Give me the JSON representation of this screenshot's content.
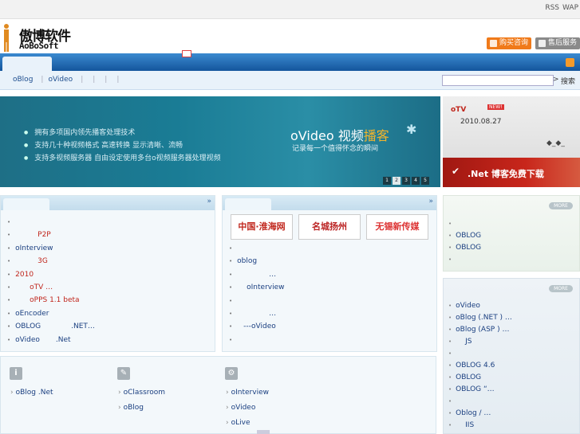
{
  "top": {
    "links": [
      "RSS",
      "WAP"
    ]
  },
  "logo": {
    "cn": "傲博软件",
    "en": "AoBoSoft"
  },
  "header": {
    "buy": "购买咨询",
    "after_sale": "售后服务"
  },
  "subnav": {
    "links": [
      "oBlog",
      "oVideo"
    ],
    "separators": [
      "|",
      "|",
      "|",
      "|",
      "|"
    ],
    "search_arrow": ">",
    "search_button": "搜索"
  },
  "banner": {
    "bullets": [
      "拥有多项国内领先播客处理技术",
      "支持几十种视频格式 高速转换 显示清晰、流畅",
      "支持多视频服务器 自由设定使用多台o视频服务器处理视频"
    ],
    "title_prefix": "oVideo 视频",
    "title_em": "播客",
    "subtitle": "记录每一个值得怀念的瞬间",
    "star": "✱",
    "pages": [
      "1",
      "2",
      "3",
      "4",
      "5"
    ]
  },
  "promo": {
    "tag": "oTV",
    "new": "NEW!",
    "date": "2010.08.27",
    "face": "◆_◆_",
    "check": "✔",
    "text": ".Net 博客免费下载"
  },
  "panel_left": {
    "chevron": "»",
    "items": [
      {
        "a": "",
        "b": ""
      },
      {
        "a": "",
        "b": "P2P"
      },
      {
        "a": "oInterview",
        "b": ""
      },
      {
        "a": "",
        "b": "3G"
      },
      {
        "a": "2010",
        "b": ""
      },
      {
        "a": "",
        "b": "oTV          …"
      },
      {
        "a": "",
        "b": "oPPS  1.1 beta"
      },
      {
        "a": "oEncoder",
        "b": ""
      },
      {
        "a": "OBLOG",
        "b": ".NET…"
      },
      {
        "a": "oVideo",
        "b": ".Net"
      }
    ]
  },
  "panel_mid": {
    "chevron": "»",
    "logos": [
      "中国·淮海网",
      "名城扬州",
      "无锡新传媒"
    ],
    "items": [
      "",
      "oblog",
      "…",
      "oInterview",
      "",
      "…",
      "---oVideo",
      ""
    ]
  },
  "side1": {
    "more": "MORE",
    "items": [
      "",
      "OBLOG",
      "OBLOG",
      ""
    ]
  },
  "side2": {
    "more": "MORE",
    "items": [
      "oVideo",
      "oBlog (.NET )  …",
      "oBlog (ASP )  …",
      "JS",
      "",
      "OBLOG 4.6",
      "OBLOG",
      "OBLOG      “…",
      "",
      "Oblog /     …",
      "IIS"
    ]
  },
  "bottom": {
    "icons": [
      "i",
      "✎",
      "⚙"
    ],
    "col1": [
      "oBlog   .Net"
    ],
    "col2": [
      "oClassroom",
      "oBlog"
    ],
    "col3": [
      "oInterview",
      "oVideo",
      "oLive"
    ]
  }
}
